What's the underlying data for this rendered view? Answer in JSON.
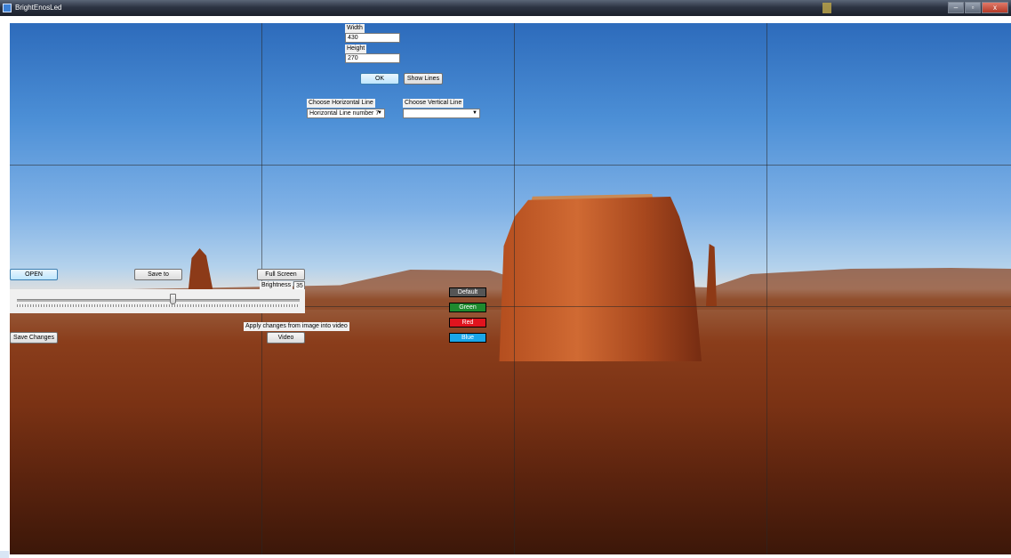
{
  "window": {
    "title": "BrightEnosLed",
    "min_label": "–",
    "max_label": "▫",
    "close_label": "x"
  },
  "dimensions": {
    "width_label": "Width",
    "width_value": "430",
    "height_label": "Height",
    "height_value": "270"
  },
  "buttons": {
    "ok": "OK",
    "show_lines": "Show Lines",
    "open": "OPEN",
    "save_to": "Save to",
    "full_screen": "Full Screen",
    "save_changes": "Save Changes",
    "video": "Video"
  },
  "lines": {
    "horizontal_label": "Choose Horizontal Line",
    "horizontal_value": "Horizontal Line number 7",
    "vertical_label": "Choose Vertical Line",
    "vertical_value": ""
  },
  "brightness": {
    "label": "Brightness",
    "value": "35",
    "level_percent": 55
  },
  "apply_label": "Apply changes from image into video",
  "color_buttons": {
    "default": "Default",
    "green": "Green",
    "red": "Red",
    "blue": "Blue"
  },
  "colors": {
    "default": "#555555",
    "green": "#1e8a2e",
    "red": "#e0141e",
    "blue": "#1aa6e8"
  }
}
